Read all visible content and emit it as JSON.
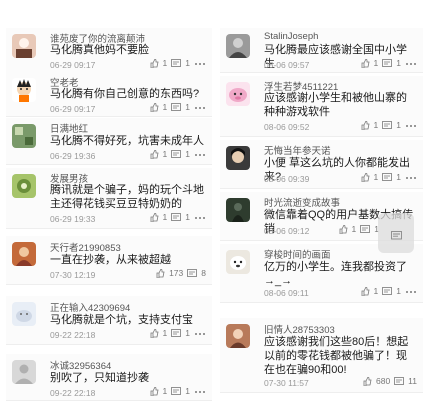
{
  "left_column": [
    {
      "user": "谁苑废了你的流离颠沛",
      "text": "马化腾真他妈不要脸",
      "date": "06-29 09:17",
      "likes": "1",
      "comment_count": "1",
      "avatar_color": "#e8c9b8"
    },
    {
      "user": "空老老",
      "text": "马化腾有你自己创意的东西吗?",
      "date": "06-29 09:17",
      "likes": "1",
      "comment_count": "1",
      "avatar_color": "#ffffff"
    },
    {
      "user": "日满地红",
      "text": "马化腾不得好死，坑害未成年人",
      "date": "06-29 19:36",
      "likes": "1",
      "comment_count": "1",
      "avatar_color": "#7a9a6a"
    },
    {
      "user": "发展男孩",
      "text": "腾讯就是个骗子，妈的玩个斗地主还得花钱买豆豆特奶奶的",
      "date": "06-29 19:33",
      "likes": "1",
      "comment_count": "1",
      "avatar_color": "#6b8f3a"
    },
    {
      "user": "天行者21990853",
      "text": "一直在抄袭，从来被超越",
      "date": "07-30 12:19",
      "likes": "173",
      "comment_count": "8",
      "avatar_color": "#c46a3a"
    },
    {
      "user": "正在输入42309694",
      "text": "马化腾就是个坑，支持支付宝",
      "date": "09-22 22:18",
      "likes": "1",
      "comment_count": "1",
      "avatar_color": "#cfd8e6"
    },
    {
      "user": "冰诚32956364",
      "text": "别吹了，只知道抄袭",
      "date": "09-22 22:18",
      "likes": "1",
      "comment_count": "1",
      "avatar_color": "#d8d8d8"
    }
  ],
  "right_column": [
    {
      "user": "StalinJoseph",
      "text": "马化腾最应该感谢全国中小学生",
      "date": "08-06 09:57",
      "likes": "1",
      "comment_count": "1",
      "avatar_color": "#9a9a9a"
    },
    {
      "user": "浮生若梦4511221",
      "text": "应该感谢小学生和被他山寨的种种游戏软件",
      "date": "08-06 09:52",
      "likes": "1",
      "comment_count": "1",
      "avatar_color": "#f0a9c8"
    },
    {
      "user": "无悔当年参天诺",
      "text": "小便 草这么坑的人你都能发出来?",
      "date": "08-06 09:39",
      "likes": "1",
      "comment_count": "1",
      "avatar_color": "#3a3a3a"
    },
    {
      "user": "时光流逝变成故事",
      "text": "微信靠着QQ的用户基数大搞传销",
      "date": "08-06 09:12",
      "likes": "1",
      "comment_count": "1",
      "avatar_color": "#2e3c2e"
    },
    {
      "user": "穿梭时间的画面",
      "text": "亿万的小学生。连我都投资了→_→",
      "date": "08-06 09:11",
      "likes": "1",
      "comment_count": "1",
      "avatar_color": "#ece8e0"
    },
    {
      "user": "旧情人28753303",
      "text": "应该感谢我们这些80后！想起以前的零花钱都被他骗了！现在也在骗90和00!",
      "date": "07-30 11:57",
      "likes": "680",
      "comment_count": "11",
      "avatar_color": "#b87a5a"
    }
  ]
}
